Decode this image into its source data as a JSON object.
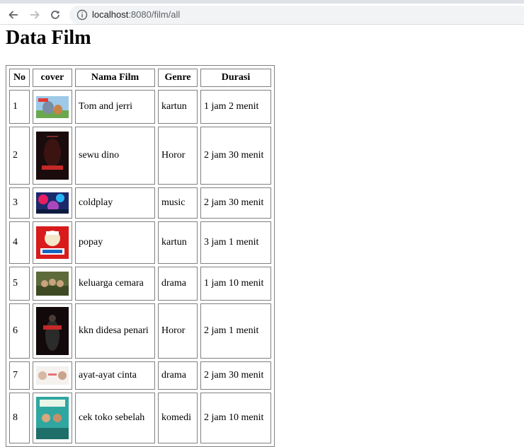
{
  "browser": {
    "url_host": "localhost",
    "url_path": ":8080/film/all"
  },
  "page": {
    "title": "Data Film"
  },
  "table": {
    "headers": [
      "No",
      "cover",
      "Nama Film",
      "Genre",
      "Durasi"
    ],
    "rows": [
      {
        "no": "1",
        "cover": "tom-and-jerri-poster",
        "name": "Tom and jerri",
        "genre": "kartun",
        "duration": "1 jam 2 menit"
      },
      {
        "no": "2",
        "cover": "sewu-dino-poster",
        "name": "sewu dino",
        "genre": "Horor",
        "duration": "2 jam 30 menit"
      },
      {
        "no": "3",
        "cover": "coldplay-poster",
        "name": "coldplay",
        "genre": "music",
        "duration": "2 jam 30 menit"
      },
      {
        "no": "4",
        "cover": "popay-poster",
        "name": "popay",
        "genre": "kartun",
        "duration": "3 jam 1 menit"
      },
      {
        "no": "5",
        "cover": "keluarga-cemara-poster",
        "name": "keluarga cemara",
        "genre": "drama",
        "duration": "1 jam 10 menit"
      },
      {
        "no": "6",
        "cover": "kkn-didesa-penari-poster",
        "name": "kkn didesa penari",
        "genre": "Horor",
        "duration": "2 jam 1 menit"
      },
      {
        "no": "7",
        "cover": "ayat-ayat-cinta-poster",
        "name": "ayat-ayat cinta",
        "genre": "drama",
        "duration": "2 jam 30 menit"
      },
      {
        "no": "8",
        "cover": "cek-toko-sebelah-poster",
        "name": "cek toko sebelah",
        "genre": "komedi",
        "duration": "2 jam 10 menit"
      }
    ]
  }
}
